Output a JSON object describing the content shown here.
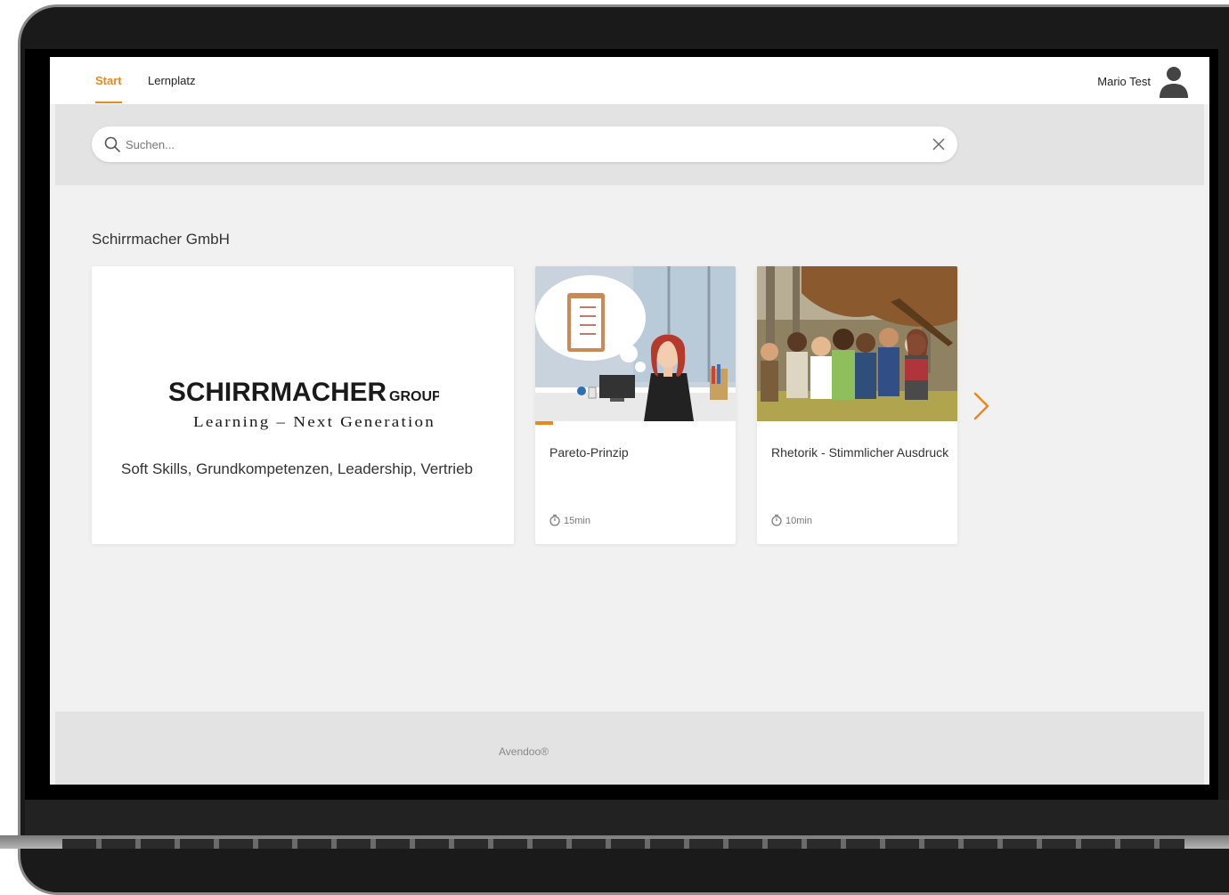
{
  "nav": {
    "tabs": [
      {
        "label": "Start",
        "active": true
      },
      {
        "label": "Lernplatz",
        "active": false
      }
    ],
    "user_name": "Mario Test"
  },
  "search": {
    "placeholder": "Suchen..."
  },
  "section": {
    "title": "Schirrmacher GmbH"
  },
  "brand_card": {
    "logo_word": "SCHIRRMACHER",
    "logo_suffix": "GROUP",
    "logo_tagline": "Learning – Next Generation",
    "description": "Soft Skills, Grundkompetenzen, Leadership, Vertrieb"
  },
  "courses": [
    {
      "title": "Pareto-Prinzip",
      "duration": "15min",
      "progress_percent": 9
    },
    {
      "title": "Rhetorik - Stimmlicher Ausdruck",
      "duration": "10min",
      "progress_percent": 0
    }
  ],
  "footer": {
    "text": "Avendoo®"
  },
  "colors": {
    "accent": "#e8891d",
    "page_bg": "#f1f1f1",
    "band_bg": "#e3e3e3"
  }
}
